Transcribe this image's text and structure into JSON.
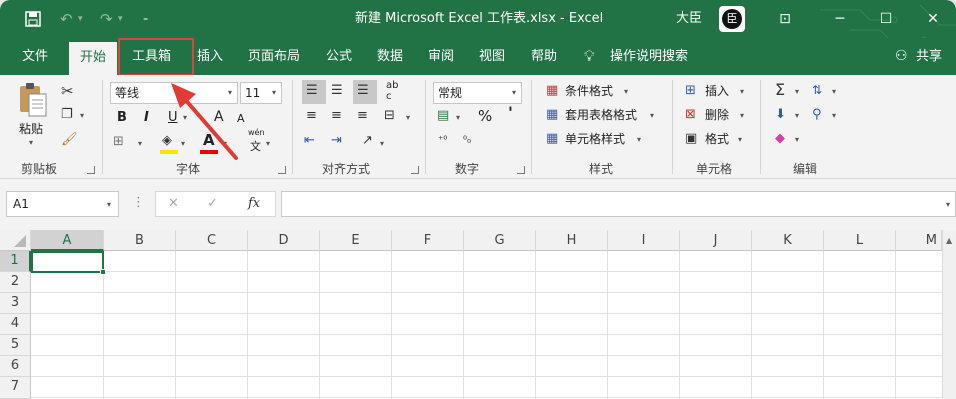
{
  "window": {
    "title": "新建 Microsoft Excel 工作表.xlsx  -  Excel",
    "user_name": "大臣",
    "avatar_text": "臣",
    "minimize": "─",
    "restore": "☐",
    "close": "✕",
    "ribbon_display": "⊡"
  },
  "tabs": [
    "文件",
    "开始",
    "工具箱",
    "插入",
    "页面布局",
    "公式",
    "数据",
    "审阅",
    "视图",
    "帮助"
  ],
  "tell_me": "操作说明搜索",
  "share": "共享",
  "ribbon": {
    "clipboard": {
      "paste": "粘贴",
      "label": "剪贴板"
    },
    "font": {
      "name": "等线",
      "size": "11",
      "bold": "B",
      "italic": "I",
      "underline": "U",
      "grow": "A",
      "shrink": "A",
      "color_letter": "A",
      "wen": "wén",
      "wen_char": "文",
      "label": "字体"
    },
    "alignment": {
      "ab": "ab",
      "c": "c",
      "label": "对齐方式"
    },
    "number": {
      "format": "常规",
      "percent": "%",
      "comma": "'",
      "label": "数字"
    },
    "styles": {
      "conditional": "条件格式",
      "table": "套用表格格式",
      "cell": "单元格样式",
      "label": "样式"
    },
    "cells": {
      "insert": "插入",
      "delete": "删除",
      "format": "格式",
      "label": "单元格"
    },
    "editing": {
      "label": "编辑"
    }
  },
  "formula_bar": {
    "name_box": "A1",
    "fx": "fx",
    "cancel": "✕",
    "enter": "✓",
    "formula": ""
  },
  "columns": [
    "A",
    "B",
    "C",
    "D",
    "E",
    "F",
    "G",
    "H",
    "I",
    "J",
    "K",
    "L",
    "M"
  ],
  "rows": [
    "1",
    "2",
    "3",
    "4",
    "5",
    "6",
    "7"
  ],
  "colors": {
    "accent": "#217346",
    "highlight_box": "#d9463d",
    "arrow": "#e03b34"
  }
}
